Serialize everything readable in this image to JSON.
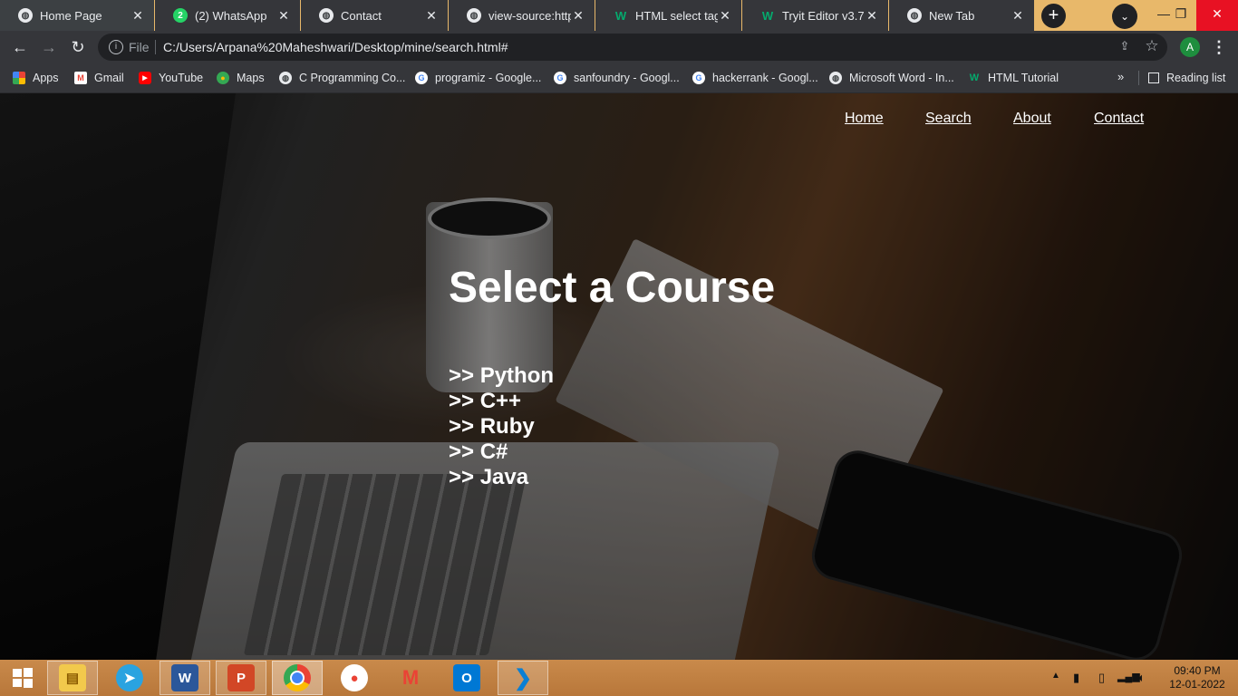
{
  "browser": {
    "tabs": [
      {
        "title": "Home Page",
        "icon": "globe-icon",
        "active": true
      },
      {
        "title": "(2) WhatsApp",
        "icon": "whatsapp-icon",
        "badge": "2"
      },
      {
        "title": "Contact",
        "icon": "globe-icon"
      },
      {
        "title": "view-source:https:/",
        "icon": "globe-icon"
      },
      {
        "title": "HTML select tag",
        "icon": "w3schools-icon"
      },
      {
        "title": "Tryit Editor v3.7",
        "icon": "w3schools-icon"
      },
      {
        "title": "New Tab",
        "icon": "chrome-icon"
      }
    ],
    "address": {
      "scheme_label": "File",
      "url": "C:/Users/Arpana%20Maheshwari/Desktop/mine/search.html#"
    },
    "profile_initial": "A",
    "bookmarks": [
      {
        "label": "Apps",
        "icon": "apps-grid-icon"
      },
      {
        "label": "Gmail",
        "icon": "gmail-icon"
      },
      {
        "label": "YouTube",
        "icon": "youtube-icon"
      },
      {
        "label": "Maps",
        "icon": "maps-icon"
      },
      {
        "label": "C Programming Co...",
        "icon": "globe-icon"
      },
      {
        "label": "programiz - Google...",
        "icon": "google-icon"
      },
      {
        "label": "sanfoundry - Googl...",
        "icon": "google-icon"
      },
      {
        "label": "hackerrank - Googl...",
        "icon": "google-icon"
      },
      {
        "label": "Microsoft Word - In...",
        "icon": "globe-icon"
      },
      {
        "label": "HTML Tutorial",
        "icon": "w3schools-icon"
      }
    ],
    "reading_list": "Reading list"
  },
  "site": {
    "nav": [
      "Home",
      "Search",
      "About",
      "Contact"
    ],
    "title": "Select a Course",
    "courses": [
      ">> Python",
      ">> C++",
      ">> Ruby",
      ">> C#",
      ">> Java"
    ]
  },
  "taskbar": {
    "apps": [
      "file-explorer-icon",
      "telegram-icon",
      "word-icon",
      "powerpoint-icon",
      "chrome-icon",
      "maps-icon",
      "gmail-icon",
      "outlook-icon",
      "vscode-icon"
    ],
    "time": "09:40 PM",
    "date": "12-01-2022"
  },
  "colors": {
    "tab_active": "#3c4043",
    "tab_strip": "#e8b86a",
    "toolbar": "#35363a",
    "omnibox": "#202124",
    "close_button": "#e81123",
    "taskbar": "#c98a4b",
    "page_text": "#ffffff"
  }
}
